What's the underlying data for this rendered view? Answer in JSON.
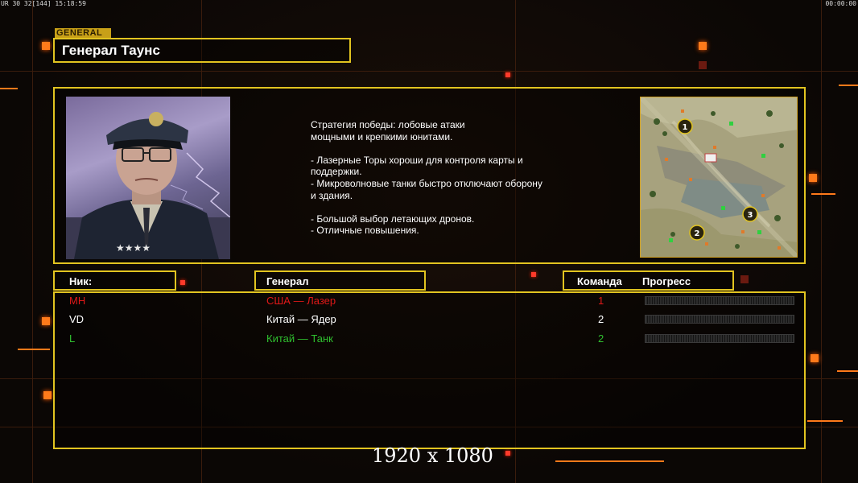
{
  "hud": {
    "left_stats": "UR 30 32[144] 15:18:59",
    "right_timer": "00:00:00"
  },
  "header": {
    "tag": "GENERAL",
    "general_name": "Генерал Таунс"
  },
  "description": "Стратегия победы: лобовые атаки\nмощными и крепкими юнитами.\n\n- Лазерные Торы хороши для контроля карты и\n поддержки.\n- Микроволновые танки быстро отключают оборону\n и здания.\n\n- Большой выбор летающих дронов.\n- Отличные повышения.",
  "columns": {
    "nick": "Ник:",
    "general": "Генерал",
    "team": "Команда",
    "progress": "Прогресс"
  },
  "players": [
    {
      "nick": "MH",
      "general": "США — Лазер",
      "team": "1",
      "color": "#e01818",
      "progress": 0
    },
    {
      "nick": "VD",
      "general": "Китай — Ядер",
      "team": "2",
      "color": "#ffffff",
      "progress": 0
    },
    {
      "nick": "L",
      "general": "Китай — Танк",
      "team": "2",
      "color": "#2fbf2f",
      "progress": 0
    }
  ],
  "minimap": {
    "markers": [
      "1",
      "2",
      "3"
    ]
  },
  "resolution_label": "1920 x 1080",
  "colors": {
    "accent": "#e2c420",
    "orange": "#ff7a1a"
  }
}
